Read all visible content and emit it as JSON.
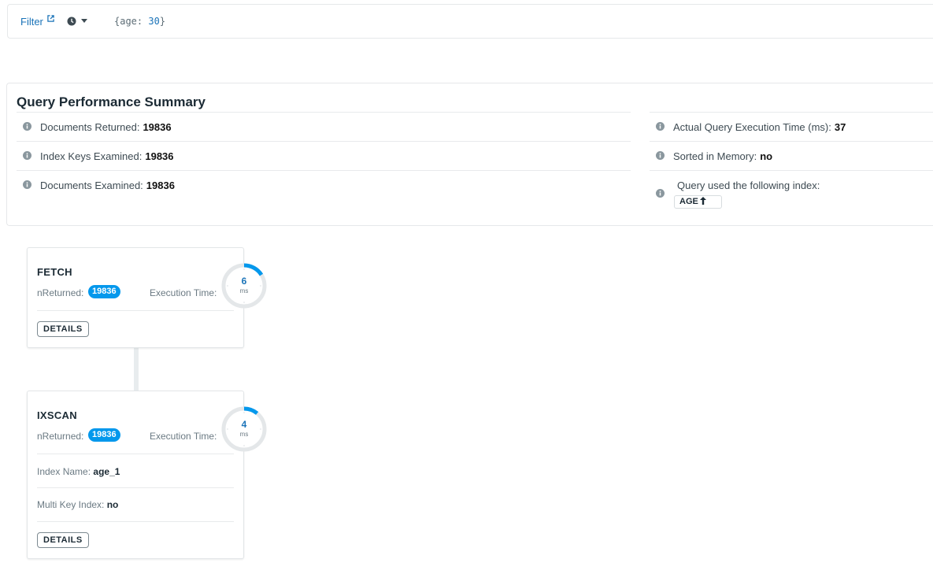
{
  "filter": {
    "label": "Filter",
    "query_open": "{age: ",
    "query_value": "30",
    "query_close": "}"
  },
  "summary": {
    "title": "Query Performance Summary",
    "left_rows": [
      {
        "label": "Documents Returned:",
        "value": "19836"
      },
      {
        "label": "Index Keys Examined:",
        "value": "19836"
      },
      {
        "label": "Documents Examined:",
        "value": "19836"
      }
    ],
    "right_rows": [
      {
        "label": "Actual Query Execution Time (ms):",
        "value": "37"
      },
      {
        "label": "Sorted in Memory:",
        "value": "no"
      }
    ],
    "index_label": "Query used the following index:",
    "index_name": "AGE"
  },
  "stages": [
    {
      "title": "FETCH",
      "nreturned_label": "nReturned:",
      "nreturned": "19836",
      "exec_label": "Execution Time:",
      "exec_ms": "6",
      "ms_label": "ms",
      "exec_fraction": 0.16,
      "details_label": "DETAILS"
    },
    {
      "title": "IXSCAN",
      "nreturned_label": "nReturned:",
      "nreturned": "19836",
      "exec_label": "Execution Time:",
      "exec_ms": "4",
      "ms_label": "ms",
      "exec_fraction": 0.11,
      "index_name_label": "Index Name:",
      "index_name": "age_1",
      "multikey_label": "Multi Key Index:",
      "multikey": "no",
      "details_label": "DETAILS"
    }
  ],
  "colors": {
    "accent": "#0498ec",
    "link": "#1a73b8",
    "gauge_track": "#e4e7e9"
  }
}
